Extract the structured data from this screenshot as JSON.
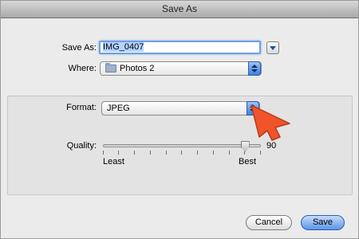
{
  "window": {
    "title": "Save As"
  },
  "save_as": {
    "label": "Save As:",
    "value": "IMG_0407"
  },
  "where": {
    "label": "Where:",
    "selected": "Photos 2",
    "folder_icon": "folder-icon"
  },
  "format": {
    "label": "Format:",
    "selected": "JPEG"
  },
  "quality": {
    "label": "Quality:",
    "value_text": "90",
    "min_label": "Least",
    "max_label": "Best",
    "level": 0.9
  },
  "buttons": {
    "cancel": "Cancel",
    "save": "Save"
  },
  "overlay": {
    "pointer": "orange-arrow-icon",
    "color": "#f0542b"
  }
}
